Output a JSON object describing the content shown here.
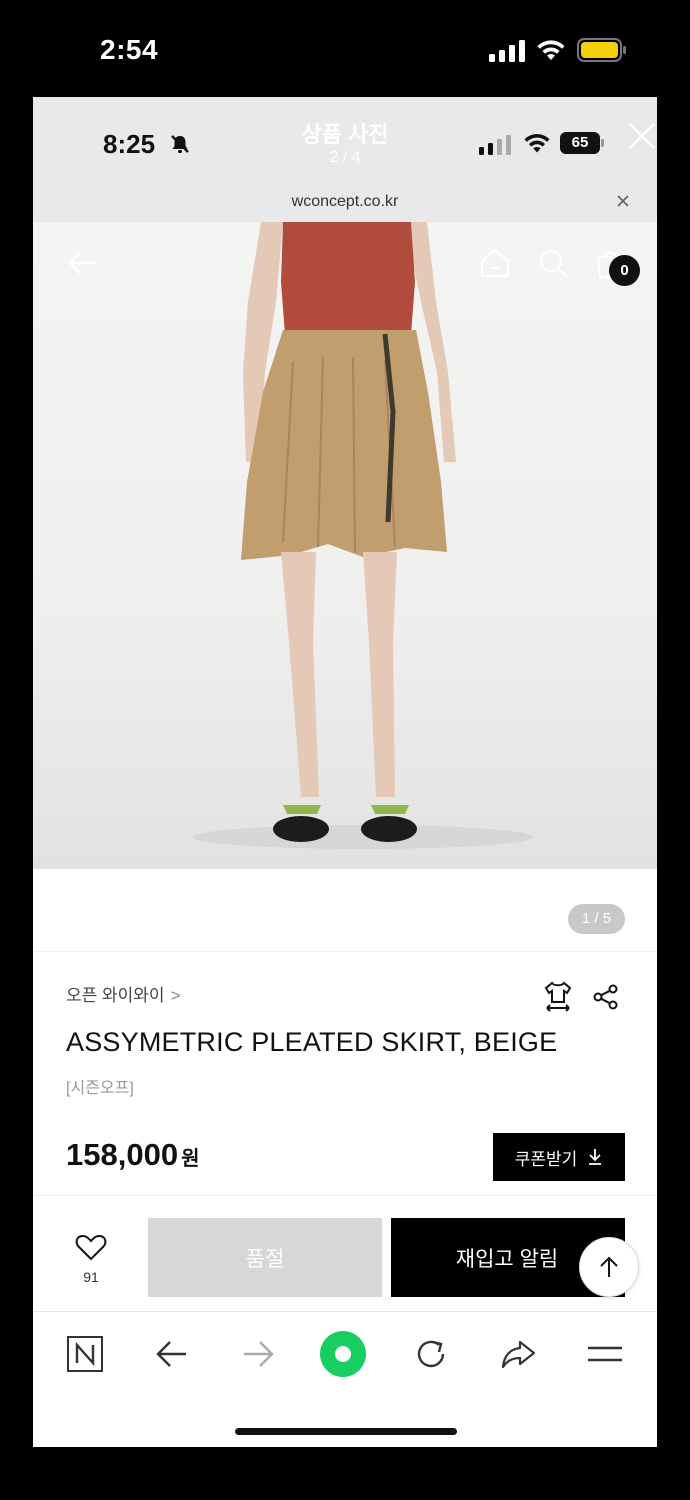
{
  "outer_status": {
    "time": "2:54",
    "battery_color": "#f5d00a"
  },
  "viewer": {
    "inner_time": "8:25",
    "title": "상품 사진",
    "counter": "2 / 4",
    "battery_level": "65",
    "url": "wconcept.co.kr"
  },
  "image_nav": {
    "cart_count": "0",
    "icons": [
      "back-arrow-icon",
      "home-icon",
      "search-icon",
      "cart-icon"
    ]
  },
  "gallery": {
    "page_indicator": "1 / 5"
  },
  "product": {
    "brand": "오픈 와이와이",
    "brand_chevron": ">",
    "title": "ASSYMETRIC PLEATED SKIRT, BEIGE",
    "season_tag": "[시즌오프]",
    "price": "158,000",
    "price_unit": "원",
    "coupon_label": "쿠폰받기"
  },
  "purchase_bar": {
    "wish_count": "91",
    "soldout_label": "품절",
    "restock_label": "재입고 알림"
  },
  "browser_toolbar": {
    "icons": [
      "naver-n-icon",
      "back-icon",
      "forward-icon",
      "green-home-icon",
      "refresh-icon",
      "share-icon",
      "menu-icon"
    ],
    "accent": "#19ce60"
  }
}
